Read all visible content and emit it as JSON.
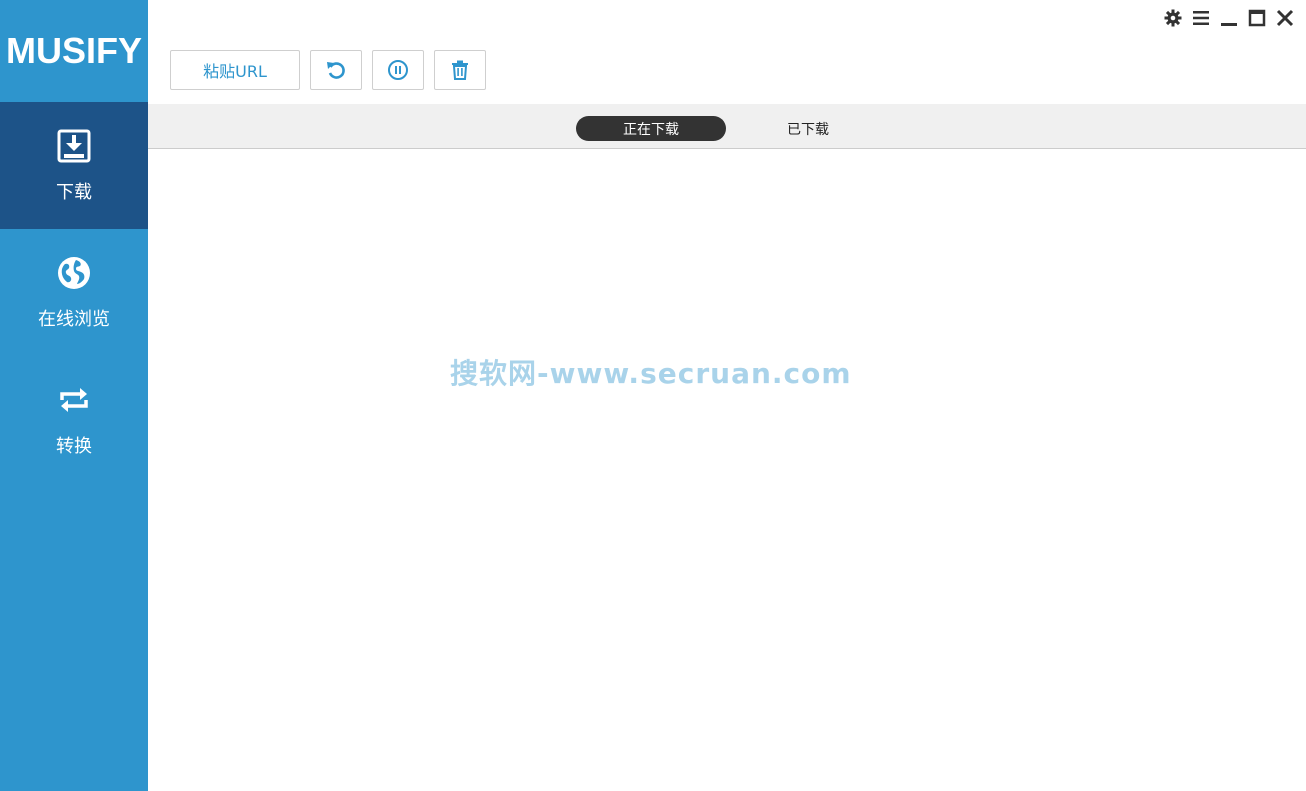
{
  "app": {
    "logo": "MUSIFY"
  },
  "sidebar": {
    "items": [
      {
        "label": "下载",
        "icon": "download-icon",
        "active": true
      },
      {
        "label": "在线浏览",
        "icon": "globe-icon",
        "active": false
      },
      {
        "label": "转换",
        "icon": "convert-icon",
        "active": false
      }
    ]
  },
  "toolbar": {
    "paste_url_label": "粘贴URL",
    "icons": [
      "refresh-icon",
      "pause-icon",
      "trash-icon"
    ]
  },
  "tabs": [
    {
      "label": "正在下载",
      "active": true
    },
    {
      "label": "已下载",
      "active": false
    }
  ],
  "watermark": "搜软网-www.secruan.com",
  "window_controls": [
    "gear-icon",
    "menu-icon",
    "minimize-icon",
    "maximize-icon",
    "close-icon"
  ],
  "colors": {
    "sidebar": "#2e95cd",
    "sidebar_active": "#1d5388",
    "accent": "#2e95cd",
    "tab_active": "#333333"
  }
}
